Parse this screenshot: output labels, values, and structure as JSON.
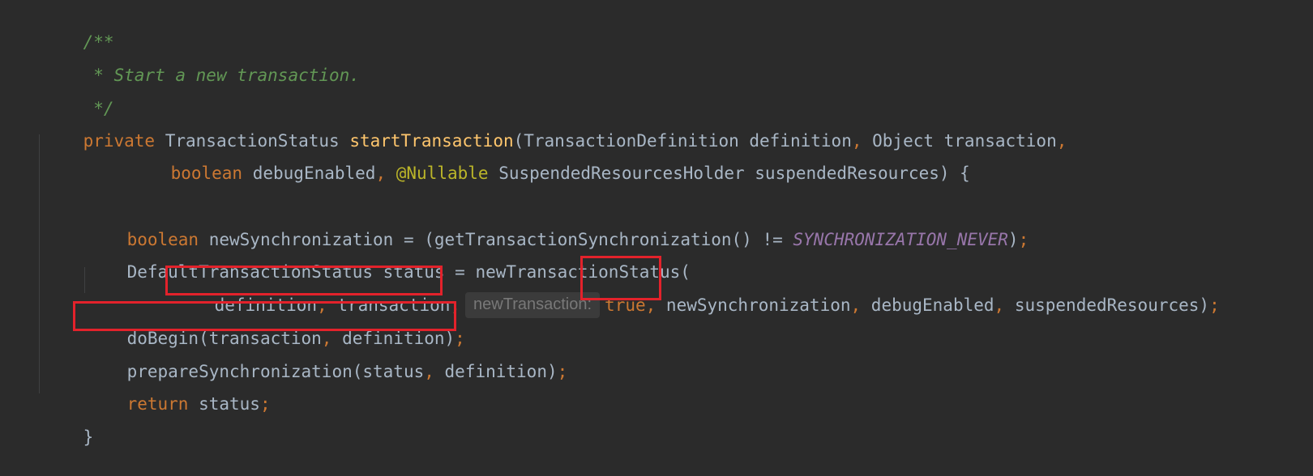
{
  "lines": {
    "l1": {
      "comment": "/**"
    },
    "l2": {
      "comment": " * Start a new transaction."
    },
    "l3": {
      "comment": " */"
    },
    "l4": {
      "kw_private": "private",
      "ret_type": " TransactionStatus ",
      "method_name": "startTransaction",
      "params1": "(TransactionDefinition definition",
      "comma1": ",",
      "params2": " Object transaction",
      "comma2": ","
    },
    "l5": {
      "kw_boolean": "boolean",
      "param_debug": " debugEnabled",
      "comma": ",",
      "annotation": " @Nullable",
      "rest": " SuspendedResourcesHolder suspendedResources) {"
    },
    "l7": {
      "kw_boolean": "boolean",
      "mid": " newSynchronization = (getTransactionSynchronization() != ",
      "constant": "SYNCHRONIZATION_NEVER",
      "close": ")",
      "semi": ";"
    },
    "l8": {
      "text": "DefaultTransactionStatus status = newTransactionStatus("
    },
    "l9": {
      "arg_definition": "definition",
      "comma1": ",",
      "arg_transaction": " transaction",
      "comma2": ",",
      "hint": "newTransaction:",
      "kw_true": "true",
      "comma3": ",",
      "arg_newsync": " newSynchronization",
      "comma4": ",",
      "arg_debug": " debugEnabled",
      "comma5": ",",
      "arg_suspended": " suspendedResources)",
      "semi": ";"
    },
    "l10": {
      "call": "doBegin(transaction",
      "comma": ",",
      "rest": " definition)",
      "semi": ";"
    },
    "l11": {
      "call": "prepareSynchronization(status",
      "comma": ",",
      "rest": " definition)",
      "semi": ";"
    },
    "l12": {
      "kw_return": "return",
      "rest": " status",
      "semi": ";"
    },
    "l13": {
      "brace": "}"
    }
  },
  "colors": {
    "background": "#2b2b2b",
    "text": "#a9b7c6",
    "keyword": "#cc7832",
    "method": "#ffc66d",
    "comment": "#629755",
    "annotation": "#bbb529",
    "constant": "#9876aa",
    "highlight_box": "#e3222b"
  }
}
